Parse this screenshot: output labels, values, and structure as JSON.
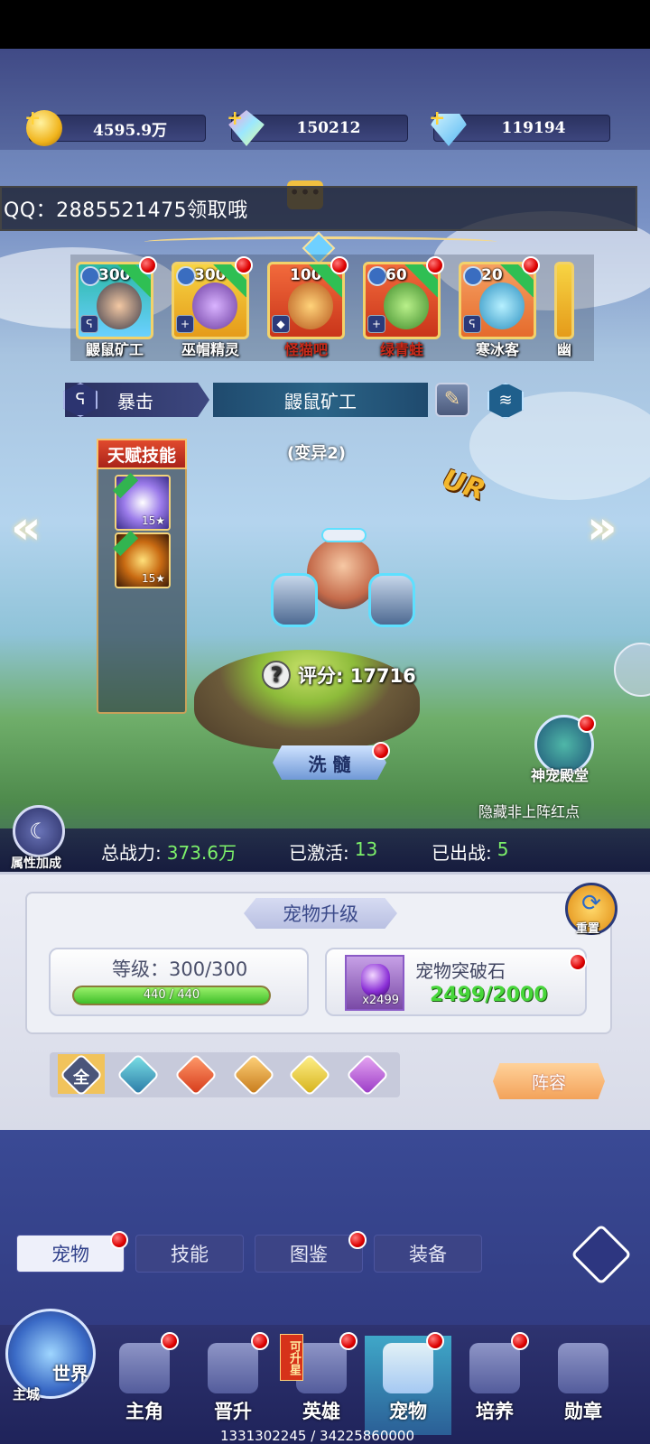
{
  "resources": {
    "gold": "4595.9万",
    "crystal": "150212",
    "diamond": "119194"
  },
  "banner": "QQ：2885521475领取哦",
  "pet_cards": [
    {
      "level": "300",
      "name": "鼹鼠矿工"
    },
    {
      "level": "300",
      "name": "巫帽精灵"
    },
    {
      "level": "100",
      "name": "怪猫吧"
    },
    {
      "level": "60",
      "name": "绿青蛙"
    },
    {
      "level": "20",
      "name": "寒冰客"
    },
    {
      "level": "",
      "name": "幽"
    }
  ],
  "selected": {
    "skill_type": "暴击",
    "name": "鼹鼠矿工",
    "variant": "(变异2)",
    "rarity": "UR",
    "score_label": "评分: 17716"
  },
  "talent": {
    "title": "天赋技能",
    "skills": [
      {
        "star": "15"
      },
      {
        "star": "15"
      }
    ]
  },
  "wash_button": "洗 髓",
  "temple_label": "神宠殿堂",
  "hide_dot_label": "隐藏非上阵红点",
  "attribute_label": "属性加成",
  "stats": {
    "power_label": "总战力:",
    "power_value": "373.6万",
    "active_label": "已激活:",
    "active_value": "13",
    "deployed_label": "已出战:",
    "deployed_value": "5"
  },
  "upgrade": {
    "title": "宠物升级",
    "reset_label": "重置",
    "level_label": "等级：300/300",
    "exp_text": "440 / 440",
    "exp_fraction": 1.0,
    "stone_name": "宠物突破石",
    "stone_count": "x2499",
    "stone_progress": "2499/2000"
  },
  "filters": {
    "all_label": "全",
    "lineup_button": "阵容"
  },
  "tabs": [
    "宠物",
    "技能",
    "图鉴",
    "装备"
  ],
  "nav": {
    "world": "世界",
    "main_city": "主城",
    "items": [
      "主角",
      "晋升",
      "英雄",
      "宠物",
      "培养",
      "勋章"
    ],
    "hero_badge": "可升星"
  },
  "footer": "1331302245 / 34225860000",
  "colors": {
    "accent_green": "#7cf06a",
    "red_dot": "#d00000",
    "gold": "#f2d26a"
  }
}
